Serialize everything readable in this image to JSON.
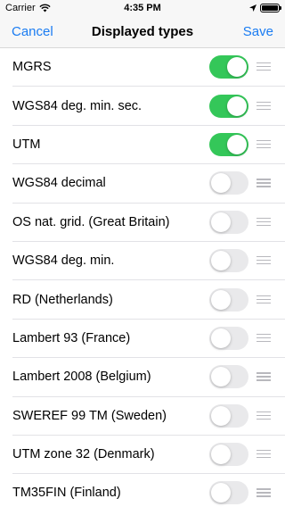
{
  "status_bar": {
    "carrier": "Carrier",
    "time": "4:35 PM"
  },
  "nav": {
    "cancel": "Cancel",
    "title": "Displayed types",
    "save": "Save"
  },
  "colors": {
    "accent": "#1a7cf2",
    "toggle_on": "#34c759",
    "toggle_off": "#e9e9eb"
  },
  "items": [
    {
      "label": "MGRS",
      "enabled": true
    },
    {
      "label": "WGS84 deg. min. sec.",
      "enabled": true
    },
    {
      "label": "UTM",
      "enabled": true
    },
    {
      "label": "WGS84 decimal",
      "enabled": false
    },
    {
      "label": "OS nat. grid. (Great Britain)",
      "enabled": false
    },
    {
      "label": "WGS84 deg. min.",
      "enabled": false
    },
    {
      "label": "RD (Netherlands)",
      "enabled": false
    },
    {
      "label": "Lambert 93 (France)",
      "enabled": false
    },
    {
      "label": "Lambert 2008 (Belgium)",
      "enabled": false
    },
    {
      "label": "SWEREF 99 TM (Sweden)",
      "enabled": false
    },
    {
      "label": "UTM zone 32 (Denmark)",
      "enabled": false
    },
    {
      "label": "TM35FIN (Finland)",
      "enabled": false
    }
  ]
}
